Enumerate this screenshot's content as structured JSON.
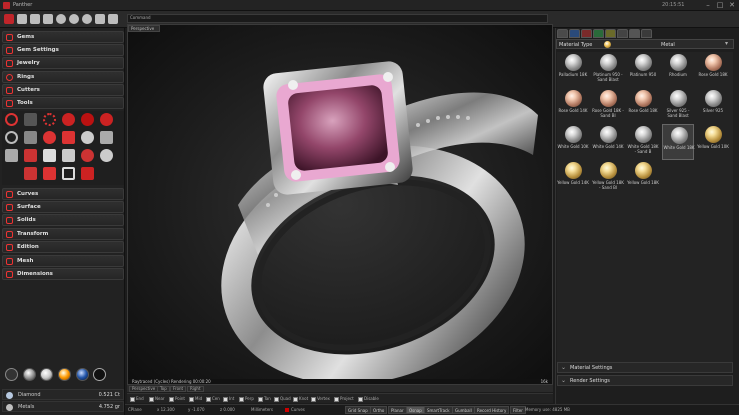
{
  "window": {
    "title": "Panther",
    "clock": "20:15:51",
    "controls": [
      "–",
      "□",
      "✕"
    ]
  },
  "command": {
    "label": "Command"
  },
  "viewport": {
    "name": "Perspective",
    "render_status": "Raytraced (Cycles)  Rendering  00:00:20",
    "render_right": "16k",
    "tabs": [
      "Perspective",
      "Top",
      "Front",
      "Right"
    ]
  },
  "left_panel": {
    "items": [
      {
        "label": "Gems",
        "icon": "gem-icon"
      },
      {
        "label": "Gem Settings",
        "icon": "gem-settings-icon"
      },
      {
        "label": "Jewelry",
        "icon": "jewelry-icon"
      },
      {
        "label": "Rings",
        "icon": "ring-icon"
      },
      {
        "label": "Cutters",
        "icon": "cutter-icon"
      },
      {
        "label": "Tools",
        "icon": "tools-icon"
      }
    ],
    "items2": [
      {
        "label": "Curves",
        "icon": "curves-icon"
      },
      {
        "label": "Surface",
        "icon": "surface-icon"
      },
      {
        "label": "Solids",
        "icon": "solids-icon"
      },
      {
        "label": "Transform",
        "icon": "transform-icon"
      },
      {
        "label": "Edition",
        "icon": "edition-icon"
      },
      {
        "label": "Mesh",
        "icon": "mesh-icon"
      },
      {
        "label": "Dimensions",
        "icon": "dimensions-icon"
      }
    ],
    "stats": [
      {
        "name": "Diamond",
        "value": "0.521 Ct",
        "color": "#b7c9e0"
      },
      {
        "name": "Metals",
        "value": "4.752 gr",
        "color": "#c0c0c0"
      }
    ]
  },
  "osnap": [
    "End",
    "Near",
    "Point",
    "Mid",
    "Cen",
    "Int",
    "Perp",
    "Tan",
    "Quad",
    "Knot",
    "Vertex",
    "Project",
    "Disable"
  ],
  "status": {
    "cplane": "CPlane",
    "x": "x 12.300",
    "y": "y -1.070",
    "z": "z 0.000",
    "units": "Millimeters",
    "layer": "Curves",
    "buttons": [
      "Grid Snap",
      "Ortho",
      "Planar",
      "Osnap",
      "SmartTrack",
      "Gumball",
      "Record History",
      "Filter"
    ],
    "memory": "Memory use: 4825 MB"
  },
  "right_panel": {
    "material_type_label": "Material Type",
    "material_type_value": "Metal",
    "materials": [
      {
        "name": "Palladium 18K",
        "tone": "silver"
      },
      {
        "name": "Platinum 950 - Sand Blast",
        "tone": "silver"
      },
      {
        "name": "Platinum 950",
        "tone": "silver"
      },
      {
        "name": "Rhodium",
        "tone": "silver"
      },
      {
        "name": "Rose Gold 18K",
        "tone": "rose"
      },
      {
        "name": "Rose Gold 14K",
        "tone": "rose"
      },
      {
        "name": "Rose Gold 18K - Sand Bl",
        "tone": "rose"
      },
      {
        "name": "Rose Gold 18K",
        "tone": "rose"
      },
      {
        "name": "Silver 925 - Sand Blast",
        "tone": "silver"
      },
      {
        "name": "Silver 925",
        "tone": "silver"
      },
      {
        "name": "White Gold 10K",
        "tone": "silver"
      },
      {
        "name": "White Gold 14K",
        "tone": "silver"
      },
      {
        "name": "White Gold 18K - Sand B",
        "tone": "silver"
      },
      {
        "name": "White Gold 18K",
        "tone": "silver"
      },
      {
        "name": "Yellow Gold 10K",
        "tone": "yellow"
      },
      {
        "name": "Yellow Gold 14K",
        "tone": "yellow"
      },
      {
        "name": "Yellow Gold 18K - Sand Bl",
        "tone": "yellow"
      },
      {
        "name": "Yellow Gold 18K",
        "tone": "yellow"
      }
    ],
    "selected_material": "White Gold 18K",
    "material_settings": "Material Settings",
    "render_settings": "Render Settings"
  }
}
